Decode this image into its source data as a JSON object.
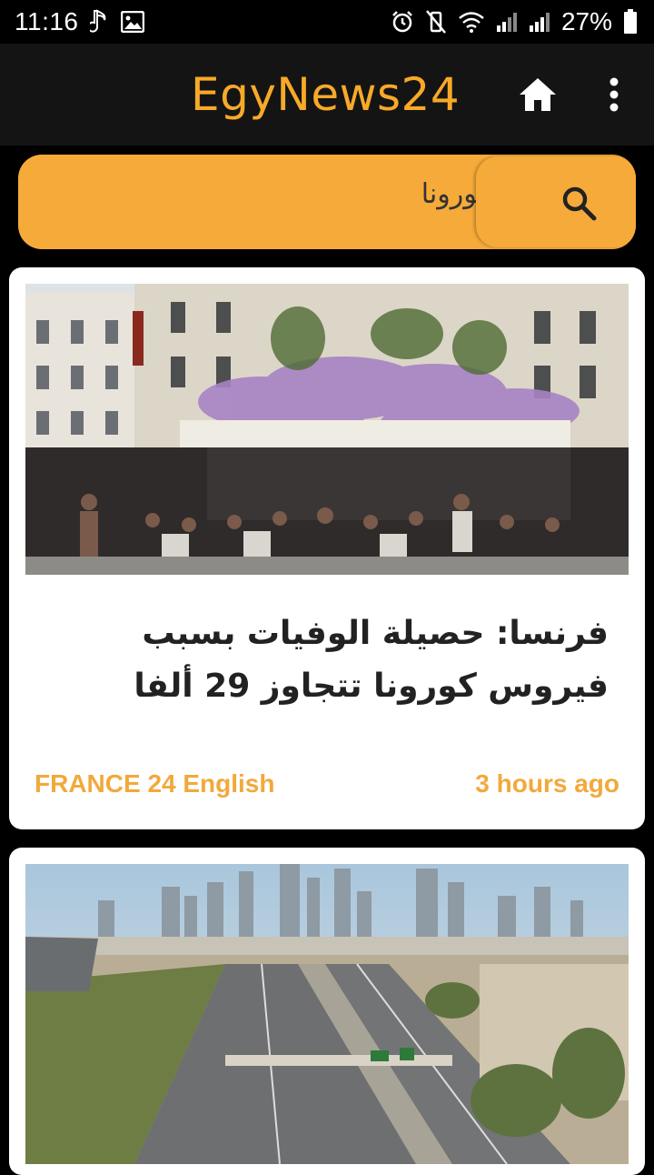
{
  "status_bar": {
    "time": "11:16",
    "battery_percent": "27%",
    "icons": [
      "music-note-icon",
      "image-icon",
      "alarm-icon",
      "vibrate-mute-icon",
      "wifi-icon",
      "signal-icon",
      "signal-icon",
      "battery-icon"
    ]
  },
  "app_bar": {
    "title": "EgyNews24",
    "accent_color": "#f7a928",
    "icons": [
      "home-icon",
      "more-vertical-icon"
    ]
  },
  "search": {
    "value": "كورونا",
    "icon": "search-icon"
  },
  "articles": [
    {
      "image": "Paris café terrace with wisteria and people seated outside",
      "title": "فرنسا: حصيلة الوفيات بسبب فيروس كورونا تتجاوز 29 ألفا",
      "source": "FRANCE 24 English",
      "time": "3 hours ago"
    },
    {
      "image": "Empty highway in Kuwait city with skyline"
    }
  ]
}
